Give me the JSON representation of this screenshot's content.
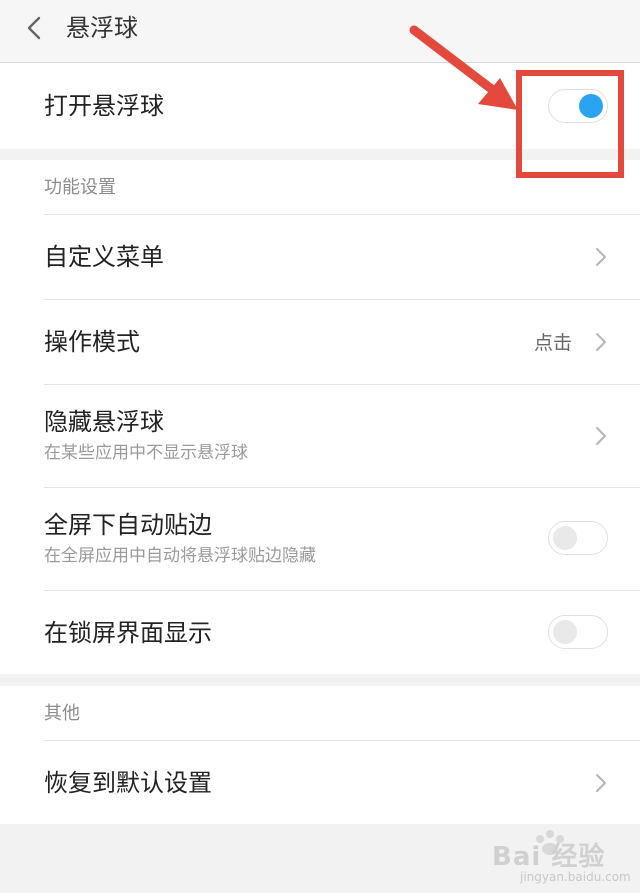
{
  "header": {
    "title": "悬浮球"
  },
  "main_toggle": {
    "label": "打开悬浮球",
    "on": true
  },
  "sections": {
    "function": {
      "title": "功能设置",
      "custom_menu": {
        "label": "自定义菜单"
      },
      "operation_mode": {
        "label": "操作模式",
        "value": "点击"
      },
      "hide_ball": {
        "label": "隐藏悬浮球",
        "subtitle": "在某些应用中不显示悬浮球"
      },
      "fullscreen_edge": {
        "label": "全屏下自动贴边",
        "subtitle": "在全屏应用中自动将悬浮球贴边隐藏",
        "on": false
      },
      "lockscreen_show": {
        "label": "在锁屏界面显示",
        "on": false
      }
    },
    "other": {
      "title": "其他",
      "restore_default": {
        "label": "恢复到默认设置"
      }
    }
  },
  "colors": {
    "accent": "#2aa4f2",
    "annotation": "#e4493d"
  },
  "watermark": {
    "brand": "Bai 经验",
    "url": "jingyan.baidu.com"
  }
}
